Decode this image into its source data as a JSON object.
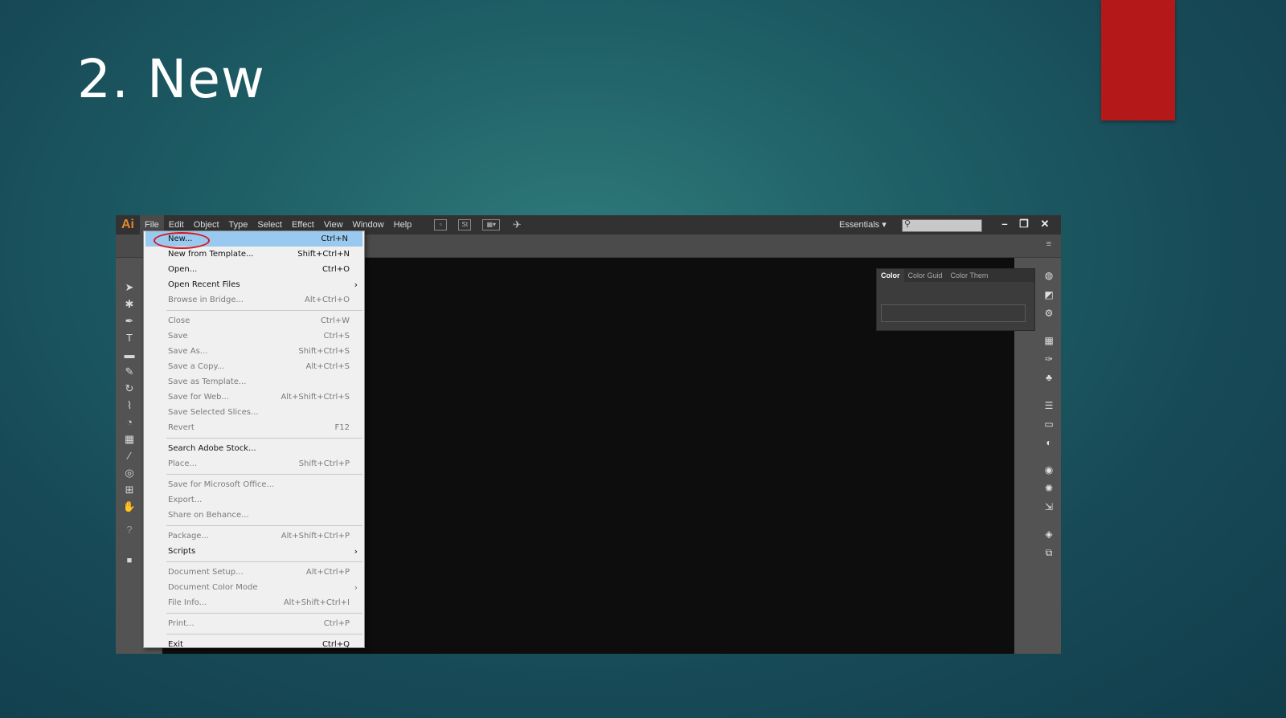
{
  "slide": {
    "title": "2. New"
  },
  "app": {
    "logo": "Ai",
    "menus": [
      "File",
      "Edit",
      "Object",
      "Type",
      "Select",
      "Effect",
      "View",
      "Window",
      "Help"
    ],
    "toolbar_icons": [
      "bridge-icon",
      "stock-icon",
      "arrange-icon",
      "gpu-icon"
    ],
    "stock_label": "St",
    "workspace": "Essentials",
    "search_placeholder": "",
    "window_controls": {
      "minimize": "–",
      "restore": "❐",
      "close": "✕"
    }
  },
  "color_panel": {
    "tabs": [
      "Color",
      "Color Guid",
      "Color Them"
    ]
  },
  "file_menu": {
    "items": [
      {
        "label": "New...",
        "shortcut": "Ctrl+N",
        "enabled": true,
        "highlighted": true
      },
      {
        "label": "New from Template...",
        "shortcut": "Shift+Ctrl+N",
        "enabled": true
      },
      {
        "label": "Open...",
        "shortcut": "Ctrl+O",
        "enabled": true
      },
      {
        "label": "Open Recent Files",
        "shortcut": "",
        "enabled": true,
        "submenu": true
      },
      {
        "label": "Browse in Bridge...",
        "shortcut": "Alt+Ctrl+O",
        "enabled": false
      },
      {
        "separator": true
      },
      {
        "label": "Close",
        "shortcut": "Ctrl+W",
        "enabled": false
      },
      {
        "label": "Save",
        "shortcut": "Ctrl+S",
        "enabled": false
      },
      {
        "label": "Save As...",
        "shortcut": "Shift+Ctrl+S",
        "enabled": false
      },
      {
        "label": "Save a Copy...",
        "shortcut": "Alt+Ctrl+S",
        "enabled": false
      },
      {
        "label": "Save as Template...",
        "shortcut": "",
        "enabled": false
      },
      {
        "label": "Save for Web...",
        "shortcut": "Alt+Shift+Ctrl+S",
        "enabled": false
      },
      {
        "label": "Save Selected Slices...",
        "shortcut": "",
        "enabled": false
      },
      {
        "label": "Revert",
        "shortcut": "F12",
        "enabled": false
      },
      {
        "separator": true
      },
      {
        "label": "Search Adobe Stock...",
        "shortcut": "",
        "enabled": true
      },
      {
        "label": "Place...",
        "shortcut": "Shift+Ctrl+P",
        "enabled": false
      },
      {
        "separator": true
      },
      {
        "label": "Save for Microsoft Office...",
        "shortcut": "",
        "enabled": false
      },
      {
        "label": "Export...",
        "shortcut": "",
        "enabled": false
      },
      {
        "label": "Share on Behance...",
        "shortcut": "",
        "enabled": false
      },
      {
        "separator": true
      },
      {
        "label": "Package...",
        "shortcut": "Alt+Shift+Ctrl+P",
        "enabled": false
      },
      {
        "label": "Scripts",
        "shortcut": "",
        "enabled": true,
        "submenu": true
      },
      {
        "separator": true
      },
      {
        "label": "Document Setup...",
        "shortcut": "Alt+Ctrl+P",
        "enabled": false
      },
      {
        "label": "Document Color Mode",
        "shortcut": "",
        "enabled": false,
        "submenu": true
      },
      {
        "label": "File Info...",
        "shortcut": "Alt+Shift+Ctrl+I",
        "enabled": false
      },
      {
        "separator": true
      },
      {
        "label": "Print...",
        "shortcut": "Ctrl+P",
        "enabled": false
      },
      {
        "separator": true
      },
      {
        "label": "Exit",
        "shortcut": "Ctrl+Q",
        "enabled": true
      }
    ]
  },
  "tools": [
    "selection-tool-icon",
    "magic-wand-tool-icon",
    "pen-tool-icon",
    "type-tool-icon",
    "rectangle-tool-icon",
    "pencil-tool-icon",
    "rotate-tool-icon",
    "warp-tool-icon",
    "shape-builder-tool-icon",
    "perspective-grid-tool-icon",
    "eyedropper-tool-icon",
    "symbol-sprayer-tool-icon",
    "artboard-tool-icon",
    "hand-tool-icon",
    "help-icon"
  ],
  "panel_icons": [
    "color-panel-icon",
    "color-guide-icon",
    "color-theme-icon",
    "swatches-icon",
    "brushes-icon",
    "symbols-icon",
    "stroke-icon",
    "gradient-icon",
    "transparency-icon",
    "appearance-icon",
    "graphic-styles-icon",
    "asset-export-icon",
    "layers-icon",
    "artboards-icon"
  ],
  "colors": {
    "accent_red": "#b51818",
    "highlight": "#99c9ee",
    "annotation": "#d9141c"
  }
}
